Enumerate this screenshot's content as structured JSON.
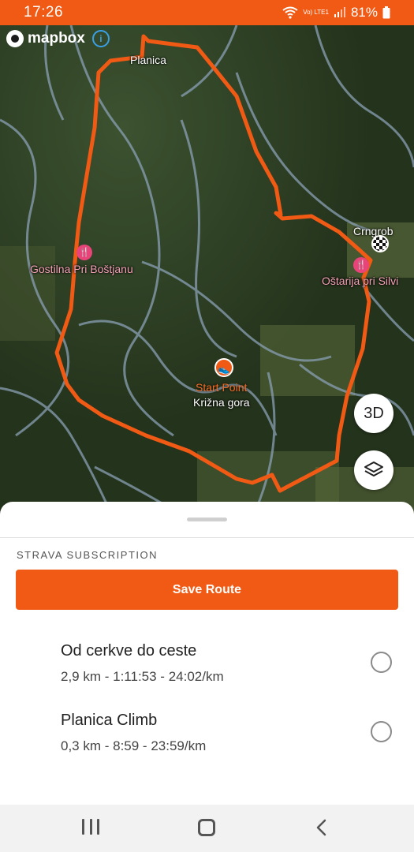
{
  "status_bar": {
    "time": "17:26",
    "battery": "81%",
    "network_label": "Vo) LTE1",
    "icons": [
      "wifi-icon",
      "volte-icon",
      "signal-icon",
      "battery-icon"
    ]
  },
  "map": {
    "brand": "mapbox",
    "labels": {
      "planica": "Planica",
      "crngrob": "Crngrob",
      "gostilna": "Gostilna Pri Boštjanu",
      "ostarija": "Oštarija pri Silvi",
      "start_point": "Start Point",
      "krizna_gora": "Križna gora"
    },
    "buttons": {
      "three_d": "3D",
      "layers_icon": "layers-icon"
    },
    "route_color": "#f05a14",
    "poi_color": "#e8447a"
  },
  "sheet": {
    "section_title": "STRAVA SUBSCRIPTION",
    "save_label": "Save Route",
    "routes": [
      {
        "name": "Od cerkve do ceste",
        "meta": "2,9 km - 1:11:53 - 24:02/km",
        "selected": false
      },
      {
        "name": "Planica Climb",
        "meta": "0,3 km - 8:59 - 23:59/km",
        "selected": false
      }
    ]
  },
  "nav": {
    "icons": [
      "recent-apps-icon",
      "home-icon",
      "back-icon"
    ]
  },
  "colors": {
    "accent": "#f05a14",
    "status_bar": "#f05a14"
  }
}
